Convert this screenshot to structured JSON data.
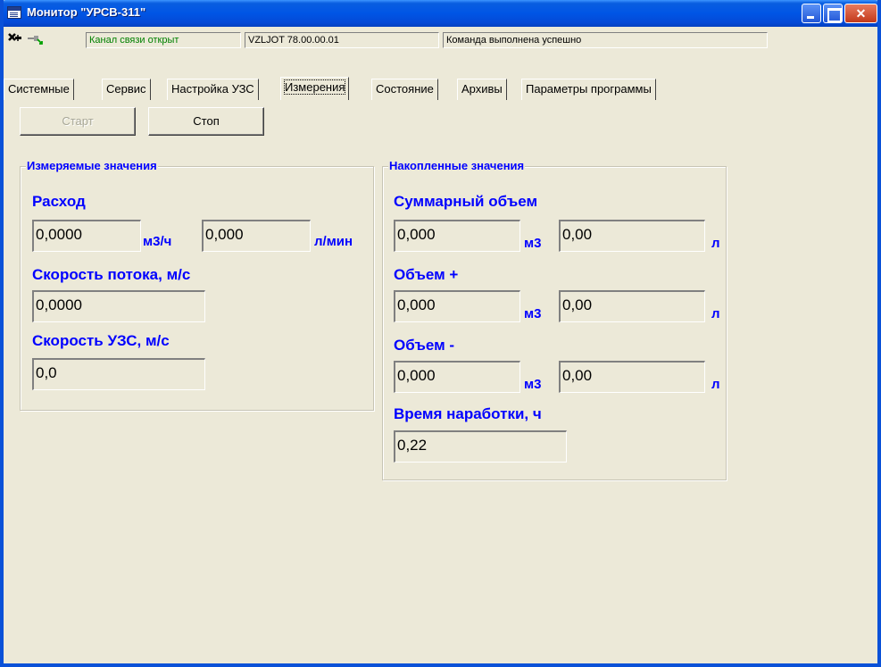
{
  "window": {
    "title": "Монитор \"УРСВ-311\"",
    "min_label": "",
    "max_label": "",
    "close_label": "✕"
  },
  "toolbar": {
    "channel_status": "Канал связи открыт",
    "device_id": "VZLJOT 78.00.00.01",
    "command_status": "Команда выполнена успешно",
    "extra_field": ""
  },
  "tabs": [
    {
      "label": "Системные"
    },
    {
      "label": "Сервис"
    },
    {
      "label": "Настройка УЗС"
    },
    {
      "label": "Измерения"
    },
    {
      "label": "Состояние"
    },
    {
      "label": "Архивы"
    },
    {
      "label": "Параметры программы"
    }
  ],
  "buttons": {
    "start": "Старт",
    "stop": "Стоп"
  },
  "measured": {
    "title": "Измеряемые значения",
    "flow_label": "Расход",
    "flow_m3h": "0,0000",
    "flow_unit_m3h": "м3/ч",
    "flow_lmin": "0,000",
    "flow_unit_lmin": "л/мин",
    "velocity_label": "Скорость потока, м/с",
    "velocity_value": "0,0000",
    "sound_speed_label": "Скорость УЗС, м/с",
    "sound_speed_value": "0,0"
  },
  "accumulated": {
    "title": "Накопленные значения",
    "total_label": "Суммарный объем",
    "total_m3": "0,000",
    "total_l": "0,00",
    "plus_label": "Объем +",
    "plus_m3": "0,000",
    "plus_l": "0,00",
    "minus_label": "Объем -",
    "minus_m3": "0,000",
    "minus_l": "0,00",
    "unit_m3": "м3",
    "unit_l": "л",
    "runtime_label": "Время наработки, ч",
    "runtime_value": "0,22"
  },
  "colors": {
    "accent_blue": "#0000ff",
    "window_bg": "#ece9d8",
    "title_bar": "#0055e5",
    "ok_text": "#008000"
  }
}
